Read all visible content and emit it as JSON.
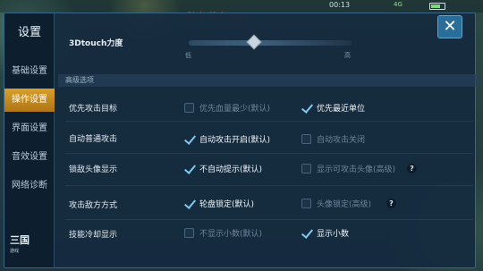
{
  "status_bar": {
    "time": "00:13",
    "network": "4G"
  },
  "watermark": "队友获力qwq",
  "sidebar": {
    "title": "设置",
    "items": [
      {
        "label": "基础设置",
        "active": false
      },
      {
        "label": "操作设置",
        "active": true
      },
      {
        "label": "界面设置",
        "active": false
      },
      {
        "label": "音效设置",
        "active": false
      },
      {
        "label": "网络诊断",
        "active": false
      }
    ],
    "logo_text": "三国",
    "logo_sub": "游戏"
  },
  "close_button": "✕",
  "touch_slider": {
    "label": "3Dtouch力度",
    "low": "低",
    "high": "高",
    "value_fraction": 0.4
  },
  "section_header": "高级选项",
  "settings": [
    {
      "label": "优先攻击目标",
      "options": [
        {
          "text": "优先血量最少(默认)",
          "checked": false
        },
        {
          "text": "优先最近单位",
          "checked": true
        }
      ]
    },
    {
      "label": "自动普通攻击",
      "options": [
        {
          "text": "自动攻击开启(默认)",
          "checked": true
        },
        {
          "text": "自动攻击关闭",
          "checked": false
        }
      ]
    },
    {
      "label": "锁敌头像显示",
      "options": [
        {
          "text": "不自动提示(默认)",
          "checked": true
        },
        {
          "text": "显示可攻击头像(高级)",
          "checked": false
        }
      ],
      "help": "?"
    },
    {
      "label": "攻击敌方方式",
      "options": [
        {
          "text": "轮盘锁定(默认)",
          "checked": true
        },
        {
          "text": "头像锁定(高级)",
          "checked": false
        }
      ],
      "help": "?"
    },
    {
      "label": "技能冷却显示",
      "options": [
        {
          "text": "不显示小数(默认)",
          "checked": false
        },
        {
          "text": "显示小数",
          "checked": true
        }
      ]
    }
  ],
  "colors": {
    "accent_tab": "#d7a02d",
    "check": "#7ec9f5",
    "watermark": "#e02a2a",
    "close": "#2a6d98"
  }
}
